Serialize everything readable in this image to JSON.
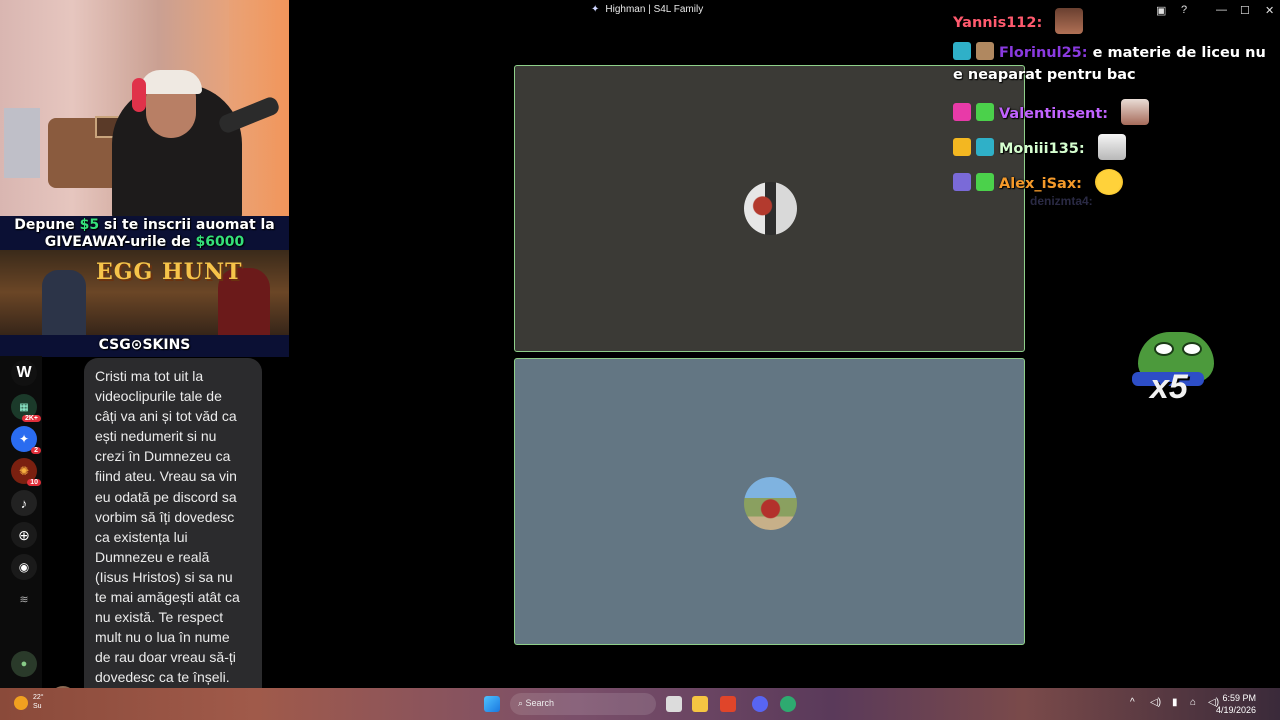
{
  "window": {
    "title": "Highman | S4L Family",
    "controls": {
      "notify": "▣",
      "help": "?",
      "minimize": "—",
      "maximize": "☐",
      "close": "✕"
    }
  },
  "promo": {
    "line1_prefix": "Depune ",
    "line1_amount": "$5",
    "line1_suffix": " si te inscrii auomat la",
    "line2_prefix": "GIVEAWAY-urile de ",
    "line2_amount": "$6000",
    "banner_title": "EGG HUNT",
    "brand": "CSG⊙SKINS"
  },
  "dock": {
    "badges": {
      "group": "2K+",
      "messenger": "2",
      "game": "10"
    }
  },
  "message": {
    "text": "Cristi ma tot uit la\nvideoclipurile tale de\ncâți va ani și tot văd ca\nești nedumerit si nu\ncrezi în Dumnezeu ca\nfiind ateu. Vreau sa vin\neu odată pe discord sa\nvorbim să îți dovedesc\nca existența lui\nDumnezeu e reală\n(Iisus Hristos) si sa nu\nte mai amăgești atât ca\nnu există. Te respect\nmult nu o lua în nume\nde rau doar vreau să-ți\ndovedesc ca te înșeli.\nLove you 🫶"
  },
  "chat": [
    {
      "user": "Yannis112:",
      "color": "#ff5a6e",
      "message": ""
    },
    {
      "user": "Florinul25:",
      "color": "#8a3ae0",
      "message": " e materie de liceu nu"
    },
    {
      "user": "",
      "color": "#ffffff",
      "message": "e neaparat pentru bac"
    },
    {
      "user": "Valentinsent:",
      "color": "#c163ff",
      "message": ""
    },
    {
      "user": "Moniii135:",
      "color": "#d6ffd0",
      "message": ""
    },
    {
      "user": "Alex_iSax:",
      "color": "#f59a2a",
      "message": ""
    },
    {
      "user": "denizmta4:",
      "color": "#2a2a44",
      "message": ""
    }
  ],
  "emote_badge": {
    "text": "x5"
  },
  "taskbar": {
    "weather_temp": "22°",
    "weather_cond": "Su",
    "search_placeholder": "Search",
    "time": "6:59 PM",
    "date": "4/19/2026"
  }
}
